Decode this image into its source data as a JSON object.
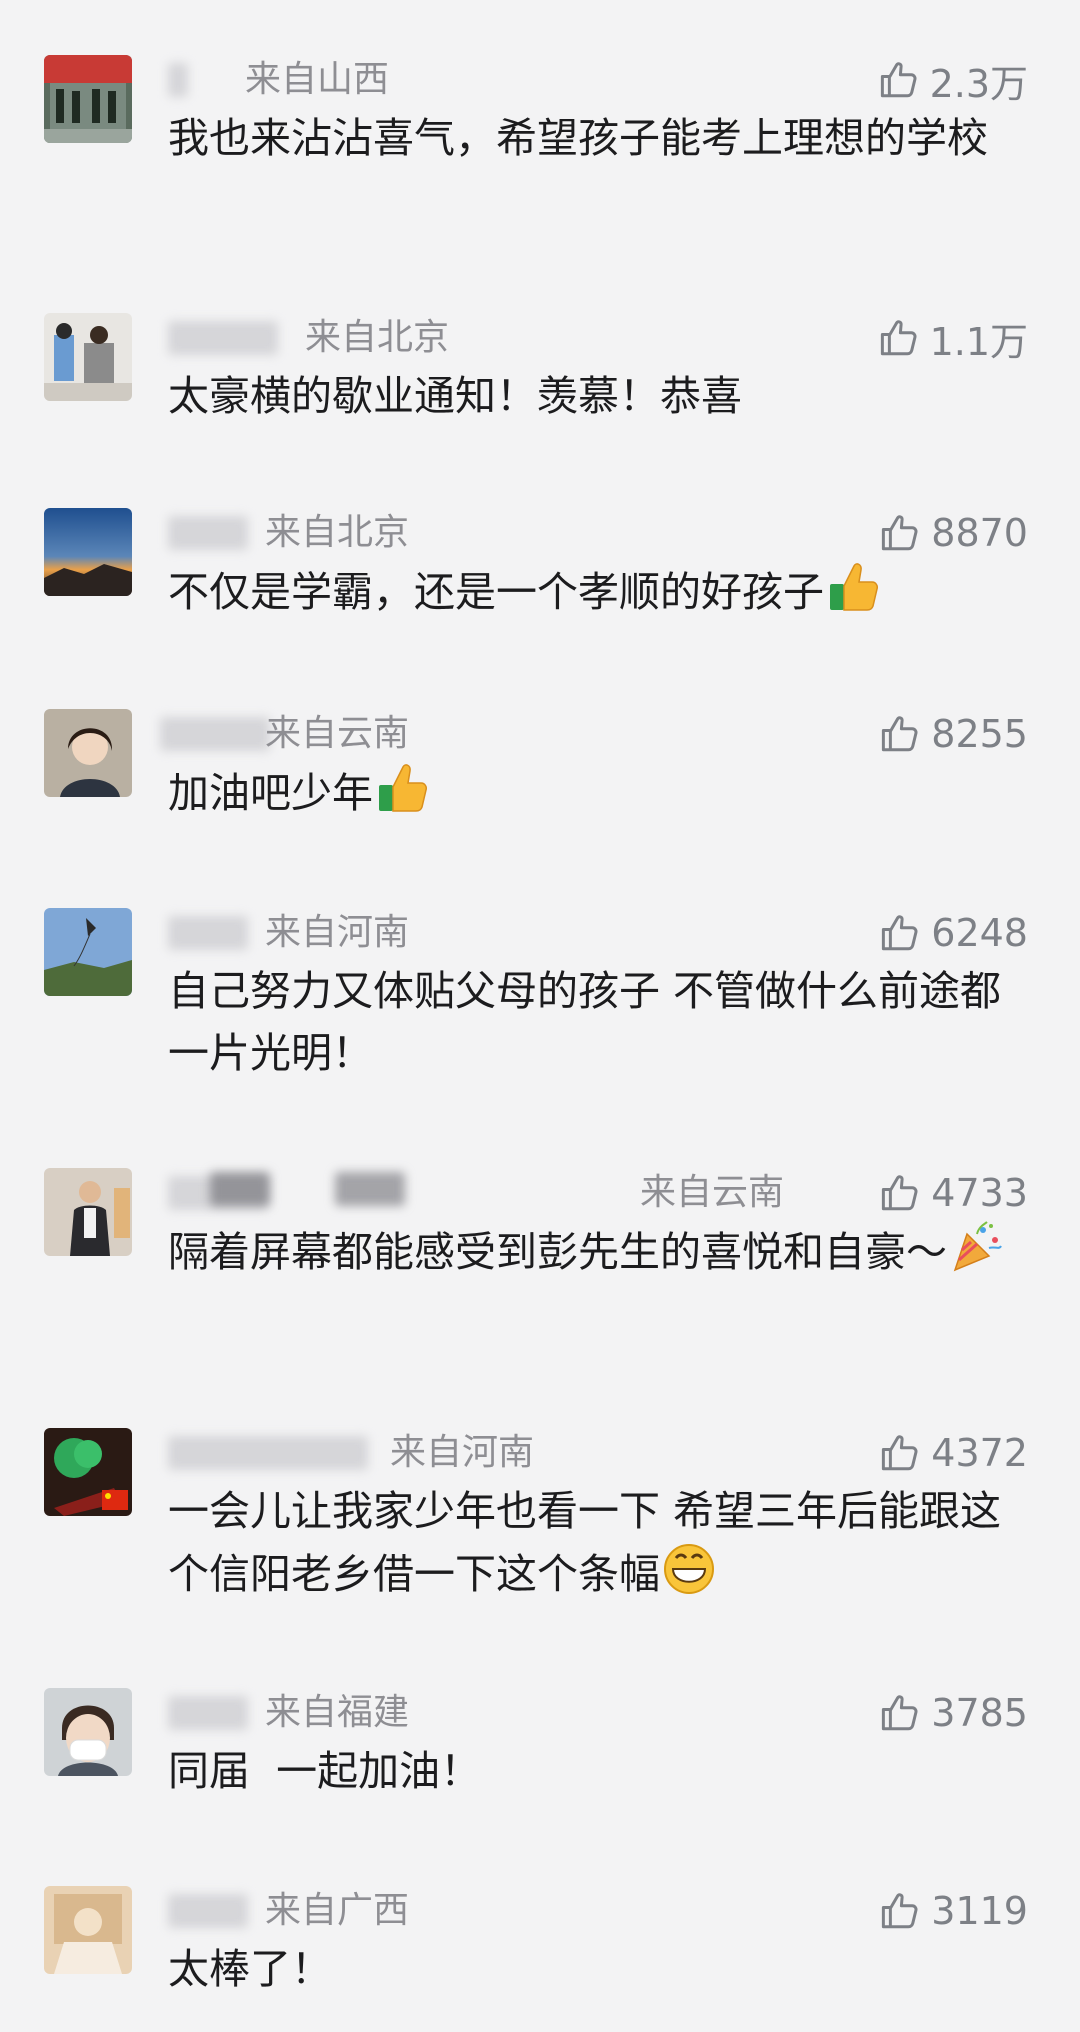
{
  "comments": [
    {
      "location": "来自山西",
      "likes": "2.3万",
      "text": "我也来沾沾喜气，希望孩子能考上理想的学校",
      "emoji": ""
    },
    {
      "location": "来自北京",
      "likes": "1.1万",
      "text": "太豪横的歇业通知！羡慕！恭喜",
      "emoji": ""
    },
    {
      "location": "来自北京",
      "likes": "8870",
      "text": "不仅是学霸，还是一个孝顺的好孩子",
      "emoji": "thumbs-up-emoji"
    },
    {
      "location": "来自云南",
      "likes": "8255",
      "text": "加油吧少年",
      "emoji": "thumbs-up-emoji"
    },
    {
      "location": "来自河南",
      "likes": "6248",
      "text": "自己努力又体贴父母的孩子 不管做什么前途都一片光明！",
      "emoji": ""
    },
    {
      "location": "来自云南",
      "likes": "4733",
      "text": "隔着屏幕都能感受到彭先生的喜悦和自豪～",
      "emoji": "party-popper-emoji"
    },
    {
      "location": "来自河南",
      "likes": "4372",
      "text": "一会儿让我家少年也看一下  希望三年后能跟这个信阳老乡借一下这个条幅",
      "emoji": "grinning-face-emoji"
    },
    {
      "location": "来自福建",
      "likes": "3785",
      "text": "同届  一起加油！",
      "emoji": ""
    },
    {
      "location": "来自广西",
      "likes": "3119",
      "text": "太棒了！",
      "emoji": ""
    }
  ],
  "colors": {
    "background": "#f3f3f4",
    "text": "#1c1c1e",
    "meta": "#8e8e93",
    "like_icon": "#7d8086"
  }
}
